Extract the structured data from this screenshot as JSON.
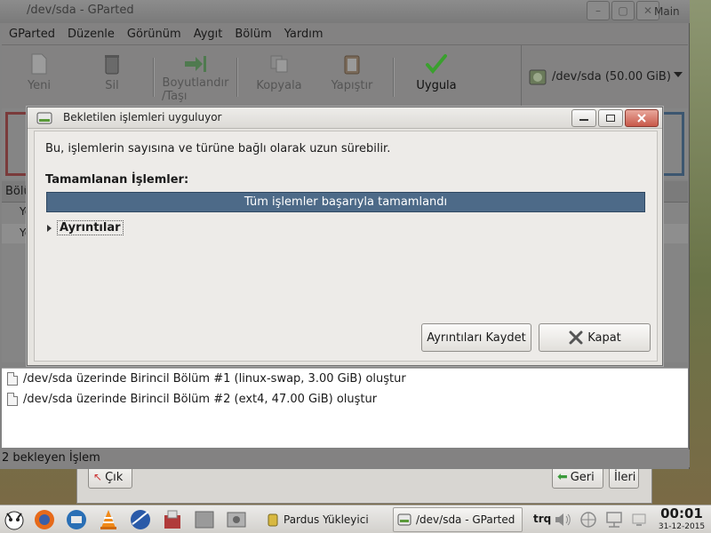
{
  "gparted": {
    "title": "/dev/sda - GParted",
    "main_label": "Main",
    "menu": [
      "GParted",
      "Düzenle",
      "Görünüm",
      "Aygıt",
      "Bölüm",
      "Yardım"
    ],
    "toolbar": {
      "new": "Yeni",
      "delete": "Sil",
      "resize_line1": "Boyutlandır",
      "resize_line2": "/Taşı",
      "copy": "Kopyala",
      "paste": "Yapıştır",
      "apply": "Uygula"
    },
    "device": "/dev/sda   (50.00 GiB)",
    "table_header": "Bölü",
    "rows": [
      "Ye",
      "Ye"
    ],
    "operations": [
      "/dev/sda üzerinde Birincil Bölüm #1 (linux-swap, 3.00 GiB) oluştur",
      "/dev/sda üzerinde Birincil Bölüm #2 (ext4, 47.00 GiB) oluştur"
    ],
    "status": "2 bekleyen İşlem"
  },
  "dialog": {
    "title": "Bekletilen işlemleri uyguluyor",
    "message": "Bu, işlemlerin sayısına ve türüne bağlı olarak uzun sürebilir.",
    "heading": "Tamamlanan İşlemler:",
    "progress_text": "Tüm işlemler başarıyla tamamlandı",
    "progress_fraction": 1.0,
    "details_label": "Ayrıntılar",
    "save_details_label": "Ayrıntıları Kaydet",
    "close_label": "Kapat"
  },
  "installer": {
    "quit_label": "Çık",
    "back_label": "Geri",
    "next_label": "İleri"
  },
  "taskbar": {
    "tasks": [
      "Pardus Yükleyici",
      "/dev/sda - GParted"
    ],
    "keyboard_layout": "trq",
    "time": "00:01",
    "date": "31-12-2015"
  },
  "colors": {
    "progress_fill": "#4d6a88",
    "apply_check": "#3aa02e",
    "close_button": "#c8594a"
  }
}
